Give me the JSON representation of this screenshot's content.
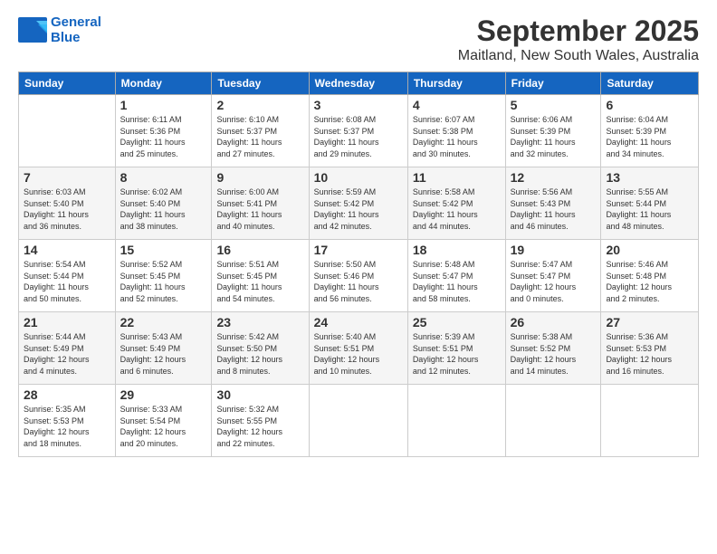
{
  "header": {
    "logo_line1": "General",
    "logo_line2": "Blue",
    "title": "September 2025",
    "location": "Maitland, New South Wales, Australia"
  },
  "days_of_week": [
    "Sunday",
    "Monday",
    "Tuesday",
    "Wednesday",
    "Thursday",
    "Friday",
    "Saturday"
  ],
  "weeks": [
    [
      {
        "day": "",
        "info": ""
      },
      {
        "day": "1",
        "info": "Sunrise: 6:11 AM\nSunset: 5:36 PM\nDaylight: 11 hours\nand 25 minutes."
      },
      {
        "day": "2",
        "info": "Sunrise: 6:10 AM\nSunset: 5:37 PM\nDaylight: 11 hours\nand 27 minutes."
      },
      {
        "day": "3",
        "info": "Sunrise: 6:08 AM\nSunset: 5:37 PM\nDaylight: 11 hours\nand 29 minutes."
      },
      {
        "day": "4",
        "info": "Sunrise: 6:07 AM\nSunset: 5:38 PM\nDaylight: 11 hours\nand 30 minutes."
      },
      {
        "day": "5",
        "info": "Sunrise: 6:06 AM\nSunset: 5:39 PM\nDaylight: 11 hours\nand 32 minutes."
      },
      {
        "day": "6",
        "info": "Sunrise: 6:04 AM\nSunset: 5:39 PM\nDaylight: 11 hours\nand 34 minutes."
      }
    ],
    [
      {
        "day": "7",
        "info": "Sunrise: 6:03 AM\nSunset: 5:40 PM\nDaylight: 11 hours\nand 36 minutes."
      },
      {
        "day": "8",
        "info": "Sunrise: 6:02 AM\nSunset: 5:40 PM\nDaylight: 11 hours\nand 38 minutes."
      },
      {
        "day": "9",
        "info": "Sunrise: 6:00 AM\nSunset: 5:41 PM\nDaylight: 11 hours\nand 40 minutes."
      },
      {
        "day": "10",
        "info": "Sunrise: 5:59 AM\nSunset: 5:42 PM\nDaylight: 11 hours\nand 42 minutes."
      },
      {
        "day": "11",
        "info": "Sunrise: 5:58 AM\nSunset: 5:42 PM\nDaylight: 11 hours\nand 44 minutes."
      },
      {
        "day": "12",
        "info": "Sunrise: 5:56 AM\nSunset: 5:43 PM\nDaylight: 11 hours\nand 46 minutes."
      },
      {
        "day": "13",
        "info": "Sunrise: 5:55 AM\nSunset: 5:44 PM\nDaylight: 11 hours\nand 48 minutes."
      }
    ],
    [
      {
        "day": "14",
        "info": "Sunrise: 5:54 AM\nSunset: 5:44 PM\nDaylight: 11 hours\nand 50 minutes."
      },
      {
        "day": "15",
        "info": "Sunrise: 5:52 AM\nSunset: 5:45 PM\nDaylight: 11 hours\nand 52 minutes."
      },
      {
        "day": "16",
        "info": "Sunrise: 5:51 AM\nSunset: 5:45 PM\nDaylight: 11 hours\nand 54 minutes."
      },
      {
        "day": "17",
        "info": "Sunrise: 5:50 AM\nSunset: 5:46 PM\nDaylight: 11 hours\nand 56 minutes."
      },
      {
        "day": "18",
        "info": "Sunrise: 5:48 AM\nSunset: 5:47 PM\nDaylight: 11 hours\nand 58 minutes."
      },
      {
        "day": "19",
        "info": "Sunrise: 5:47 AM\nSunset: 5:47 PM\nDaylight: 12 hours\nand 0 minutes."
      },
      {
        "day": "20",
        "info": "Sunrise: 5:46 AM\nSunset: 5:48 PM\nDaylight: 12 hours\nand 2 minutes."
      }
    ],
    [
      {
        "day": "21",
        "info": "Sunrise: 5:44 AM\nSunset: 5:49 PM\nDaylight: 12 hours\nand 4 minutes."
      },
      {
        "day": "22",
        "info": "Sunrise: 5:43 AM\nSunset: 5:49 PM\nDaylight: 12 hours\nand 6 minutes."
      },
      {
        "day": "23",
        "info": "Sunrise: 5:42 AM\nSunset: 5:50 PM\nDaylight: 12 hours\nand 8 minutes."
      },
      {
        "day": "24",
        "info": "Sunrise: 5:40 AM\nSunset: 5:51 PM\nDaylight: 12 hours\nand 10 minutes."
      },
      {
        "day": "25",
        "info": "Sunrise: 5:39 AM\nSunset: 5:51 PM\nDaylight: 12 hours\nand 12 minutes."
      },
      {
        "day": "26",
        "info": "Sunrise: 5:38 AM\nSunset: 5:52 PM\nDaylight: 12 hours\nand 14 minutes."
      },
      {
        "day": "27",
        "info": "Sunrise: 5:36 AM\nSunset: 5:53 PM\nDaylight: 12 hours\nand 16 minutes."
      }
    ],
    [
      {
        "day": "28",
        "info": "Sunrise: 5:35 AM\nSunset: 5:53 PM\nDaylight: 12 hours\nand 18 minutes."
      },
      {
        "day": "29",
        "info": "Sunrise: 5:33 AM\nSunset: 5:54 PM\nDaylight: 12 hours\nand 20 minutes."
      },
      {
        "day": "30",
        "info": "Sunrise: 5:32 AM\nSunset: 5:55 PM\nDaylight: 12 hours\nand 22 minutes."
      },
      {
        "day": "",
        "info": ""
      },
      {
        "day": "",
        "info": ""
      },
      {
        "day": "",
        "info": ""
      },
      {
        "day": "",
        "info": ""
      }
    ]
  ]
}
